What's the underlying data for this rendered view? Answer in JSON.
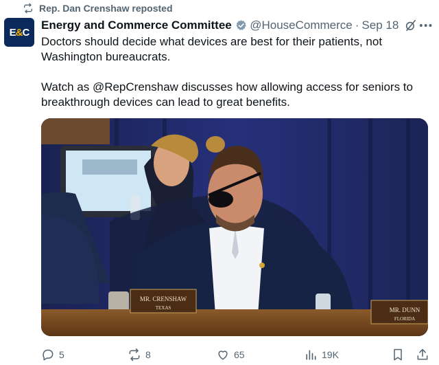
{
  "repost": {
    "text": "Rep. Dan Crenshaw reposted"
  },
  "avatar": {
    "left": "E",
    "amp": "&",
    "right": "C"
  },
  "post": {
    "author_name": "Energy and Commerce Committee",
    "handle": "@HouseCommerce",
    "separator": "·",
    "date": "Sep 18",
    "paragraphs": [
      "Doctors should decide what devices are best for their patients, not Washington bureaucrats.",
      "Watch as @RepCrenshaw discusses how allowing access for seniors to breakthrough devices can lead to great benefits."
    ]
  },
  "media": {
    "nameplate_left_name": "MR. CRENSHAW",
    "nameplate_left_state": "TEXAS",
    "nameplate_right_name": "MR. DUNN",
    "nameplate_right_state": "FLORIDA"
  },
  "actions": {
    "replies": "5",
    "reposts": "8",
    "likes": "65",
    "views": "19K"
  },
  "colors": {
    "muted": "#536471",
    "verified": "#829aab",
    "avatar_bg": "#0b2a5b"
  }
}
